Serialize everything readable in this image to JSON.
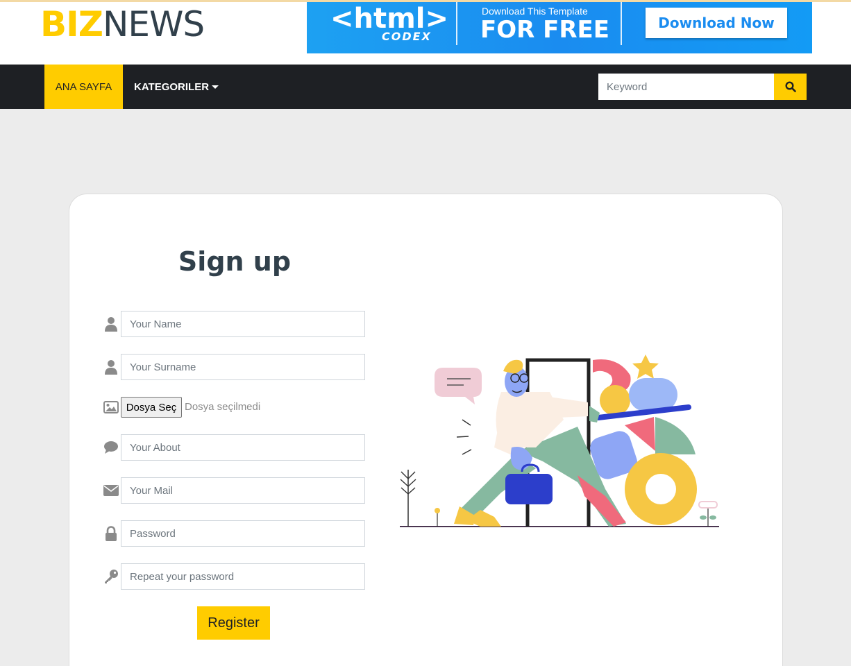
{
  "logo": {
    "part1": "BIZ",
    "part2": "NEWS"
  },
  "banner": {
    "brand": "<html>",
    "brand_sub": "CODEX",
    "tagline_small": "Download This Template",
    "tagline_big": "FOR FREE",
    "button_label": "Download Now"
  },
  "nav": {
    "home_label": "ANA SAYFA",
    "categories_label": "KATEGORILER",
    "search_placeholder": "Keyword"
  },
  "form": {
    "title": "Sign up",
    "name_placeholder": "Your Name",
    "surname_placeholder": "Your Surname",
    "file_button_label": "Dosya Seç",
    "file_status": "Dosya seçilmedi",
    "about_placeholder": "Your About",
    "mail_placeholder": "Your Mail",
    "password_placeholder": "Password",
    "repeat_password_placeholder": "Repeat your password",
    "register_label": "Register"
  },
  "colors": {
    "accent": "#ffcc00",
    "navbar": "#1e2024",
    "page_bg": "#ececec",
    "banner_blue": "#1a8cf0",
    "icon_gray": "#8a8a8a"
  },
  "icons": {
    "name_row": "user-icon",
    "surname_row": "user-icon",
    "image_row": "image-icon",
    "about_row": "comment-icon",
    "mail_row": "envelope-icon",
    "password_row": "lock-icon",
    "repeat_row": "key-icon",
    "search": "search-icon"
  }
}
